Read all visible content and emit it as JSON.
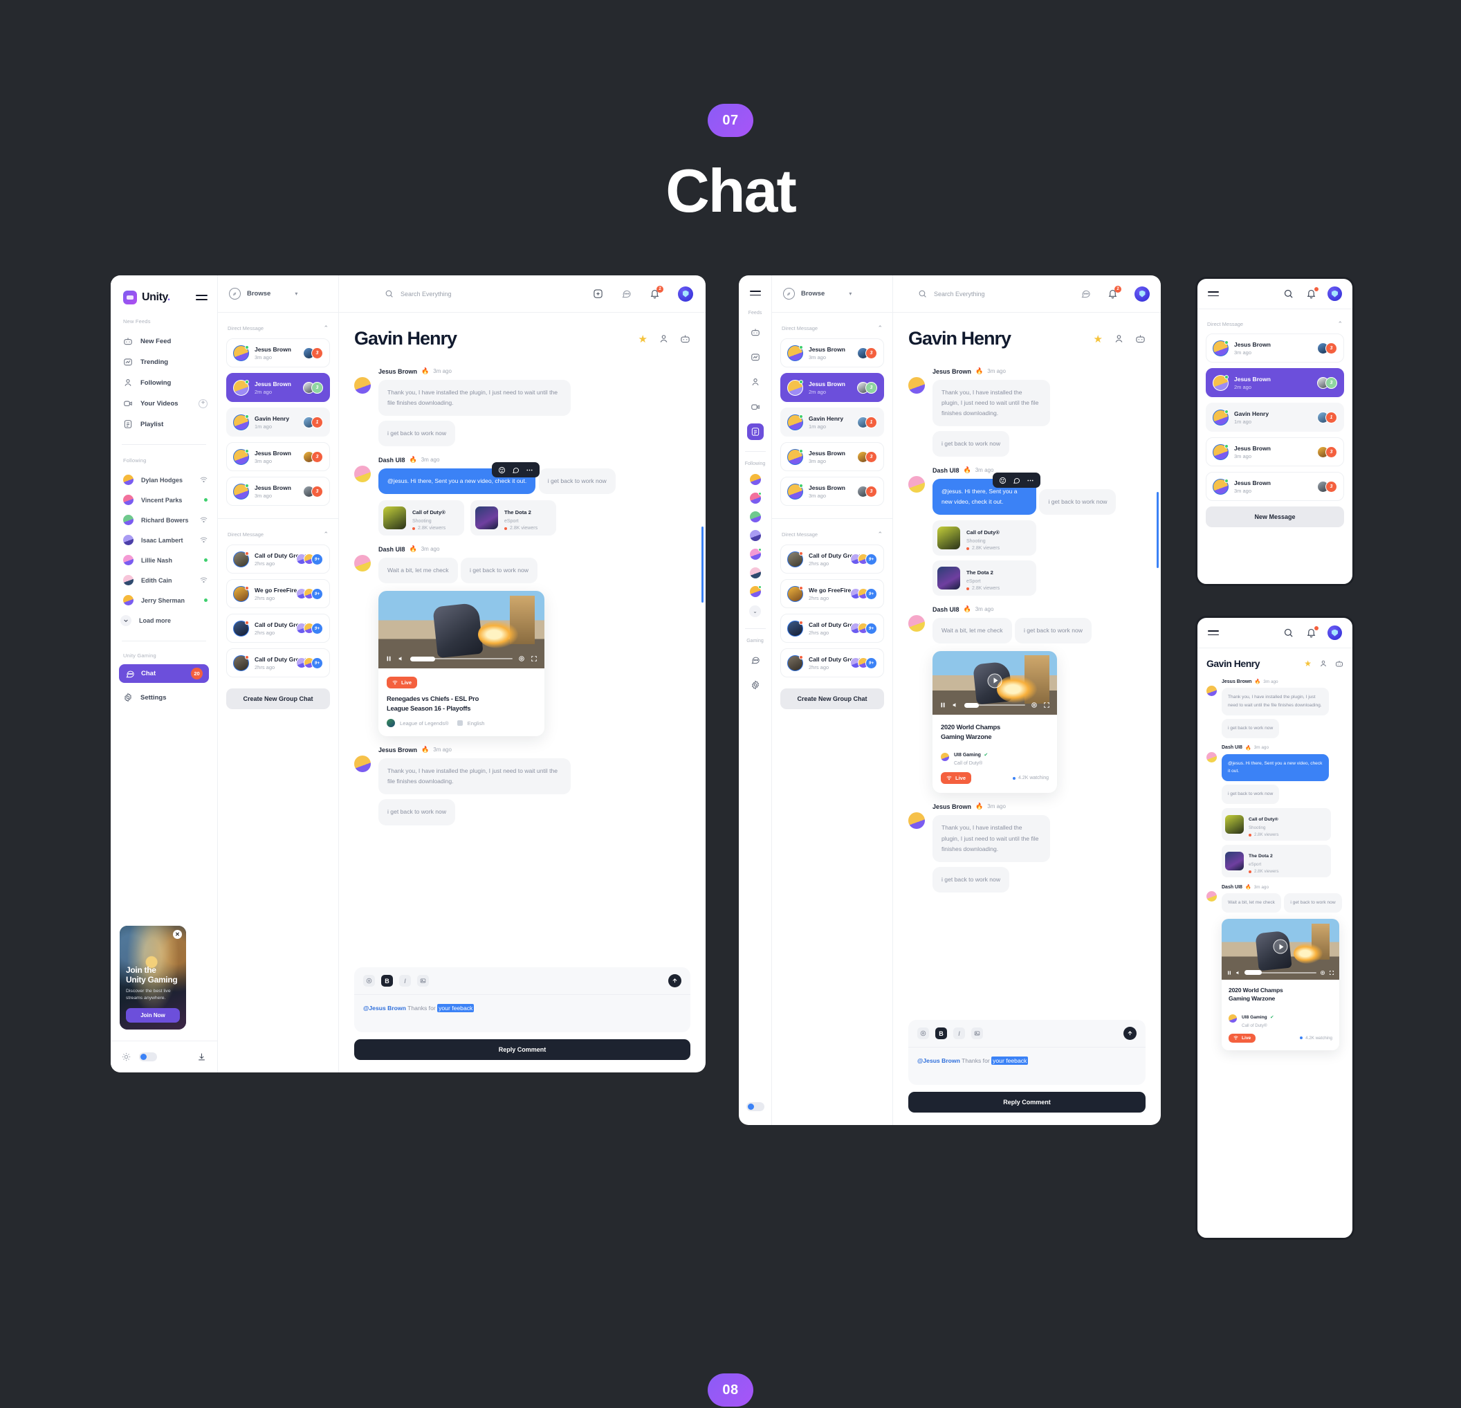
{
  "page": {
    "number_top": "07",
    "title": "Chat",
    "number_bottom": "08"
  },
  "brand": {
    "name": "Unity",
    "dot": "."
  },
  "sidebar": {
    "section_feeds_label": "New Feeds",
    "nav": [
      {
        "label": "New Feed",
        "icon": "robot-icon"
      },
      {
        "label": "Trending",
        "icon": "trending-icon"
      },
      {
        "label": "Following",
        "icon": "person-icon"
      },
      {
        "label": "Your Videos",
        "icon": "video-icon",
        "action": "+"
      },
      {
        "label": "Playlist",
        "icon": "playlist-icon"
      }
    ],
    "section_following_label": "Following",
    "following": [
      {
        "name": "Dylan Hodges",
        "status": "wifi",
        "color1": "#f6b93b",
        "color2": "#7a5cf0"
      },
      {
        "name": "Vincent Parks",
        "status": "online",
        "color1": "#f2719c",
        "color2": "#7a5cf0"
      },
      {
        "name": "Richard Bowers",
        "status": "wifi",
        "color1": "#6fc98d",
        "color2": "#7a5cf0"
      },
      {
        "name": "Isaac Lambert",
        "status": "wifi",
        "color1": "#a99bf3",
        "color2": "#4b3fa8"
      },
      {
        "name": "Lillie Nash",
        "status": "online",
        "color1": "#f49ad4",
        "color2": "#7a5cf0"
      },
      {
        "name": "Edith Cain",
        "status": "wifi",
        "color1": "#f7c5d9",
        "color2": "#2f4a6e"
      },
      {
        "name": "Jerry Sherman",
        "status": "online",
        "color1": "#f6b93b",
        "color2": "#7a5cf0"
      }
    ],
    "load_more": "Load more",
    "section_gaming_label": "Unity Gaming",
    "chat_item": {
      "label": "Chat",
      "badge": "20"
    },
    "settings_item": {
      "label": "Settings"
    }
  },
  "promo": {
    "heading_line1": "Join the",
    "heading_line2": "Unity Gaming",
    "sub_line1": "Discover the best live",
    "sub_line2": "streams anywhere.",
    "button": "Join Now",
    "close": "✕"
  },
  "topbar": {
    "browse": "Browse",
    "search_placeholder": "Search Everything",
    "notification_badge": "2"
  },
  "dm_list": {
    "header": "Direct Message",
    "rows": [
      {
        "name": "Jesus Brown",
        "time": "3m ago",
        "count": "3",
        "state": "default",
        "thumb": "#2c4a7a",
        "presence": "online"
      },
      {
        "name": "Jesus Brown",
        "time": "2m ago",
        "count": "3",
        "state": "active",
        "thumb": "#cdd2d8",
        "presence": "online"
      },
      {
        "name": "Gavin Henry",
        "time": "1m ago",
        "count": "1",
        "state": "soft",
        "thumb": "#4e7ba8",
        "presence": "online"
      },
      {
        "name": "Jesus Brown",
        "time": "3m ago",
        "count": "3",
        "state": "default",
        "thumb": "#d8a14a",
        "presence": "online"
      },
      {
        "name": "Jesus Brown",
        "time": "3m ago",
        "count": "3",
        "state": "default",
        "thumb": "#6a7480",
        "presence": "online"
      }
    ]
  },
  "group_list": {
    "header": "Direct Message",
    "rows": [
      {
        "name": "Call of Duty Group",
        "time": "2hrs ago",
        "count": "9+",
        "thumb": "#6a6458"
      },
      {
        "name": "We go FreeFire",
        "time": "2hrs ago",
        "count": "9+",
        "thumb": "#d8a14a"
      },
      {
        "name": "Call of Duty Group",
        "time": "2hrs ago",
        "count": "9+",
        "thumb": "#2a3a5c"
      },
      {
        "name": "Call of Duty Group",
        "time": "2hrs ago",
        "count": "9+",
        "thumb": "#5c5349"
      }
    ],
    "create_button": "Create New Group Chat"
  },
  "chat": {
    "title": "Gavin Henry",
    "messages": [
      {
        "author": "Jesus Brown",
        "fire": "🔥",
        "time": "3m ago",
        "text1": "Thank you, I have installed the plugin, I just need to wait until the file finishes downloading.",
        "text2": "i get back to work now"
      },
      {
        "author": "Dash UI8",
        "fire": "🔥",
        "time": "3m ago",
        "text1": "@jesus. Hi there, Sent you a new video, check it out.",
        "text2": "i get back to work now"
      },
      {
        "author": "Dash UI8",
        "fire": "🔥",
        "time": "3m ago",
        "text1": "Wait a bit, let me check",
        "text2": "i get back to work now"
      },
      {
        "author": "Jesus Brown",
        "fire": "🔥",
        "time": "3m ago",
        "text1": "Thank you, I have installed the plugin, I just need to wait until the file finishes downloading.",
        "text2": "i get back to work now"
      }
    ],
    "game_cards": [
      {
        "name": "Call of Duty®",
        "genre": "Shooting",
        "viewers": "2.8K viewers"
      },
      {
        "name": "The Dota 2",
        "genre": "eSport",
        "viewers": "2.8K viewers"
      }
    ],
    "video_card": {
      "live": "Live",
      "title_line1": "Renegades vs Chiefs - ESL Pro",
      "title_line2": "League Season 16 - Playoffs",
      "game": "League of Legends®",
      "language": "English"
    },
    "video_card_mobile": {
      "live": "Live",
      "title_line1": "2020 World Champs",
      "title_line2": "Gaming Warzone",
      "channel": "UI8 Gaming",
      "game": "Call of Duty®",
      "watching": "4.2K watching"
    },
    "composer": {
      "mention": "@Jesus Brown",
      "text": "Thanks for ",
      "highlight": "your feeback",
      "bold_label": "B",
      "italic_label": "I"
    },
    "reply_button": "Reply Comment"
  },
  "rail": {
    "feeds_label": "Feeds",
    "following_label": "Following",
    "gaming_label": "Gaming"
  },
  "mobile": {
    "new_message": "New Message"
  },
  "colors": {
    "purple": "#6c4fdb",
    "blue": "#3b82f6",
    "orange": "#f4603e",
    "dark": "#1d2330",
    "bg": "#26292e"
  }
}
